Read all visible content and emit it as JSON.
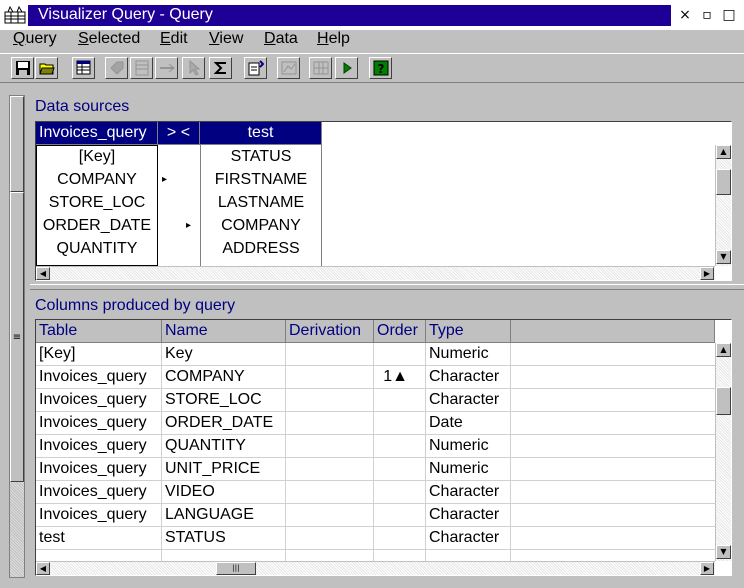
{
  "window": {
    "title": "Visualizer Query - Query",
    "controls": [
      "×",
      "▫",
      "□"
    ]
  },
  "menubar": [
    {
      "label": "Query",
      "name": "menu-query"
    },
    {
      "label": "Selected",
      "name": "menu-selected"
    },
    {
      "label": "Edit",
      "name": "menu-edit"
    },
    {
      "label": "View",
      "name": "menu-view"
    },
    {
      "label": "Data",
      "name": "menu-data"
    },
    {
      "label": "Help",
      "name": "menu-help"
    }
  ],
  "toolbar": [
    {
      "icon": "save-icon",
      "enabled": true
    },
    {
      "icon": "open-folder-icon",
      "enabled": true
    },
    {
      "icon": "table-select-icon",
      "enabled": true
    },
    {
      "icon": "tag-icon",
      "enabled": false
    },
    {
      "icon": "delete-table-icon",
      "enabled": false
    },
    {
      "icon": "link-icon",
      "enabled": false
    },
    {
      "icon": "pointer-icon",
      "enabled": false
    },
    {
      "icon": "sigma-icon",
      "enabled": true
    },
    {
      "icon": "insert-column-icon",
      "enabled": true
    },
    {
      "icon": "chart-icon",
      "enabled": false
    },
    {
      "icon": "grid-icon",
      "enabled": false
    },
    {
      "icon": "run-icon",
      "enabled": true
    },
    {
      "icon": "help-icon",
      "enabled": true
    }
  ],
  "data_sources": {
    "label": "Data sources",
    "left_table": {
      "name": "Invoices_query",
      "fields": [
        "[Key]",
        "COMPANY",
        "STORE_LOC",
        "ORDER_DATE",
        "QUANTITY"
      ]
    },
    "join_header": "> <",
    "join_markers": [
      "",
      "▸",
      "",
      "▸",
      ""
    ],
    "right_table": {
      "name": "test",
      "fields": [
        "STATUS",
        "FIRSTNAME",
        "LASTNAME",
        "COMPANY",
        "ADDRESS"
      ]
    }
  },
  "columns_pane": {
    "label": "Columns produced by query",
    "headers": [
      "Table",
      "Name",
      "Derivation",
      "Order",
      "Type"
    ],
    "rows": [
      {
        "table": "[Key]",
        "name": "Key",
        "derivation": "",
        "order": "",
        "type": "Numeric"
      },
      {
        "table": "Invoices_query",
        "name": "COMPANY",
        "derivation": "",
        "order": "1▲",
        "type": "Character"
      },
      {
        "table": "Invoices_query",
        "name": "STORE_LOC",
        "derivation": "",
        "order": "",
        "type": "Character"
      },
      {
        "table": "Invoices_query",
        "name": "ORDER_DATE",
        "derivation": "",
        "order": "",
        "type": "Date"
      },
      {
        "table": "Invoices_query",
        "name": "QUANTITY",
        "derivation": "",
        "order": "",
        "type": "Numeric"
      },
      {
        "table": "Invoices_query",
        "name": "UNIT_PRICE",
        "derivation": "",
        "order": "",
        "type": "Numeric"
      },
      {
        "table": "Invoices_query",
        "name": "VIDEO",
        "derivation": "",
        "order": "",
        "type": "Character"
      },
      {
        "table": "Invoices_query",
        "name": "LANGUAGE",
        "derivation": "",
        "order": "",
        "type": "Character"
      },
      {
        "table": "test",
        "name": "STATUS",
        "derivation": "",
        "order": "",
        "type": "Character"
      }
    ]
  },
  "colors": {
    "title_bar": "#1e0096",
    "selected_header": "#000080",
    "pane_label": "#000080"
  }
}
